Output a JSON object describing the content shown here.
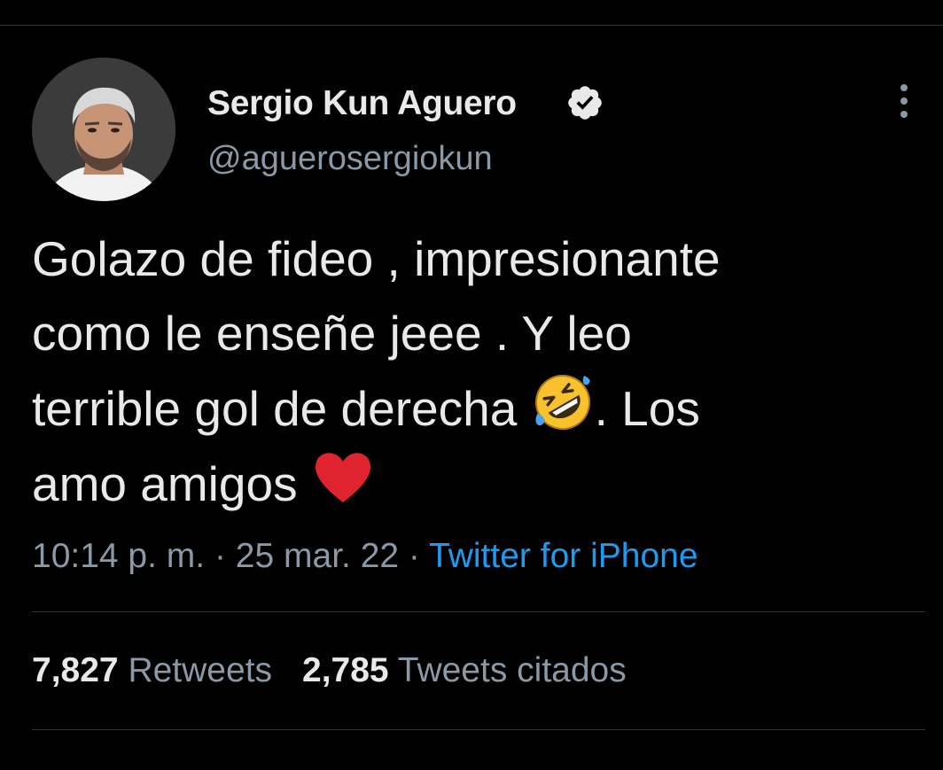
{
  "author": {
    "display_name": "Sergio Kun Aguero",
    "handle": "@aguerosergiokun",
    "verified": true
  },
  "tweet": {
    "lines": [
      "Golazo de fideo , impresionante",
      "como le enseñe jeee . Y leo",
      "terrible gol de derecha",
      ". Los",
      "amo amigos"
    ],
    "emojis": [
      "rolling-on-floor-laughing-emoji",
      "red-heart-emoji"
    ]
  },
  "meta": {
    "time": "10:14 p. m.",
    "separator": " · ",
    "date": "25 mar. 22",
    "source": "Twitter for iPhone"
  },
  "stats": {
    "retweets_count": "7,827",
    "retweets_label": "Retweets",
    "quotes_count": "2,785",
    "quotes_label": "Tweets citados"
  },
  "colors": {
    "background": "#000000",
    "text_primary": "#e7e9ea",
    "text_secondary": "#8b98a5",
    "link": "#1d9bf0",
    "divider": "#2f3336"
  },
  "icons": {
    "verified": "verified-badge-icon",
    "more": "more-options-icon"
  }
}
